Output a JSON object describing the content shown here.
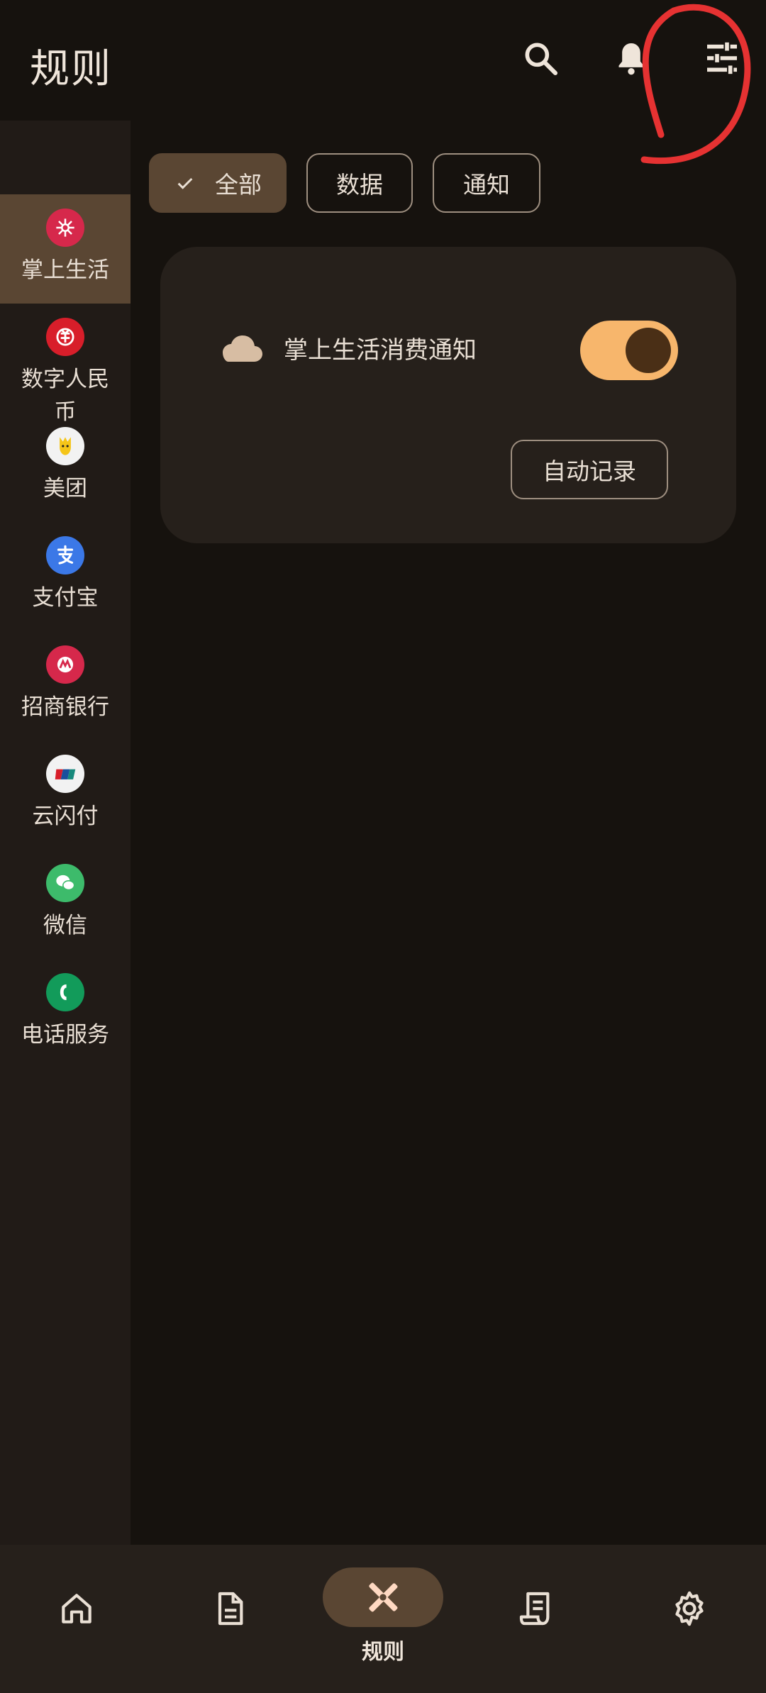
{
  "header": {
    "title": "规则",
    "icons": [
      "search-icon",
      "bell-icon",
      "tune-icon"
    ]
  },
  "sidebar": {
    "items": [
      {
        "label": "掌上生活",
        "icon": "zhangshang-icon",
        "color": "#d6284b",
        "active": true
      },
      {
        "label": "数字人民币",
        "icon": "ecny-icon",
        "color": "#d81e2a",
        "active": false
      },
      {
        "label": "美团",
        "icon": "meituan-icon",
        "color": "#f2f2f2",
        "active": false
      },
      {
        "label": "支付宝",
        "icon": "alipay-icon",
        "color": "#3b78e7",
        "active": false
      },
      {
        "label": "招商银行",
        "icon": "cmb-icon",
        "color": "#d6284b",
        "active": false
      },
      {
        "label": "云闪付",
        "icon": "unionpay-icon",
        "color": "#f2f2f2",
        "active": false
      },
      {
        "label": "微信",
        "icon": "wechat-icon",
        "color": "#3dbb6b",
        "active": false
      },
      {
        "label": "电话服务",
        "icon": "phone-icon",
        "color": "#129b5a",
        "active": false
      }
    ]
  },
  "filters": {
    "chips": [
      {
        "label": "全部",
        "selected": true
      },
      {
        "label": "数据",
        "selected": false
      },
      {
        "label": "通知",
        "selected": false
      }
    ]
  },
  "card": {
    "rule_name": "掌上生活消费通知",
    "enabled": true,
    "auto_record_label": "自动记录"
  },
  "bottom_nav": {
    "items": [
      {
        "label": "",
        "icon": "home-icon"
      },
      {
        "label": "",
        "icon": "document-icon"
      },
      {
        "label": "规则",
        "icon": "rules-icon",
        "active": true
      },
      {
        "label": "",
        "icon": "receipt-icon"
      },
      {
        "label": "",
        "icon": "gear-icon"
      }
    ]
  },
  "colors": {
    "background": "#16120e",
    "surface": "#211b17",
    "accent": "#f7b66c",
    "selected": "#5a4633"
  }
}
